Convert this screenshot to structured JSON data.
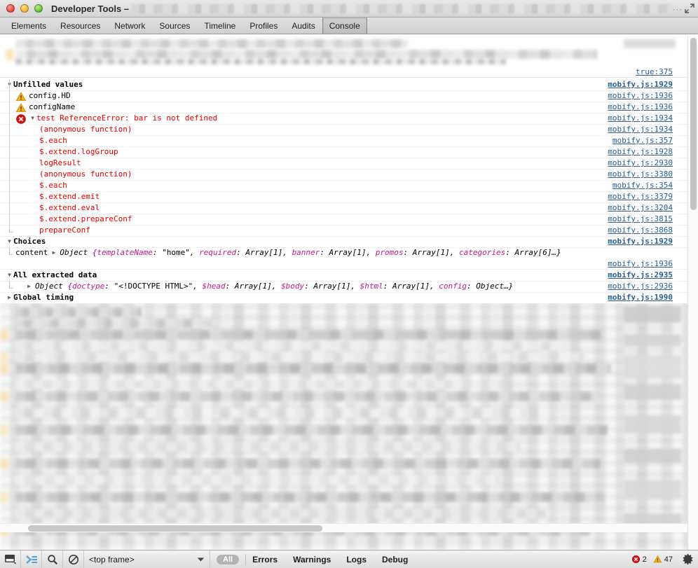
{
  "window": {
    "title": "Developer Tools –",
    "title_redacted": true,
    "ellipsis": "···",
    "controls": [
      "close",
      "minimize",
      "zoom"
    ],
    "resize_icon": "fullscreen-icon"
  },
  "tabs": [
    {
      "label": "Elements",
      "active": false
    },
    {
      "label": "Resources",
      "active": false
    },
    {
      "label": "Network",
      "active": false
    },
    {
      "label": "Sources",
      "active": false
    },
    {
      "label": "Timeline",
      "active": false
    },
    {
      "label": "Profiles",
      "active": false
    },
    {
      "label": "Audits",
      "active": false
    },
    {
      "label": "Console",
      "active": true
    }
  ],
  "console": {
    "top_source_link": "true:375",
    "groups": [
      {
        "name": "Unfilled values",
        "expanded": true,
        "source": "mobify.js:1929",
        "source_bold": true,
        "entries": [
          {
            "icon": "warning-icon",
            "text": "config.HD",
            "source": "mobify.js:1936",
            "level": "warning"
          },
          {
            "icon": "warning-icon",
            "text": "configName",
            "source": "mobify.js:1936",
            "level": "warning"
          }
        ]
      }
    ],
    "error_entry": {
      "icon": "error-icon",
      "expanded": true,
      "message": "test ReferenceError: bar is not defined",
      "source": "mobify.js:1934",
      "stack": [
        {
          "frame": "(anonymous function)",
          "source": "mobify.js:1934"
        },
        {
          "frame": "$.each",
          "source": "mobify.js:357"
        },
        {
          "frame": "$.extend.logGroup",
          "source": "mobify.js:1928"
        },
        {
          "frame": "logResult",
          "source": "mobify.js:2930"
        },
        {
          "frame": "(anonymous function)",
          "source": "mobify.js:3380"
        },
        {
          "frame": "$.each",
          "source": "mobify.js:354"
        },
        {
          "frame": "$.extend.emit",
          "source": "mobify.js:3379"
        },
        {
          "frame": "$.extend.eval",
          "source": "mobify.js:3204"
        },
        {
          "frame": "$.extend.prepareConf",
          "source": "mobify.js:3815"
        },
        {
          "frame": "prepareConf",
          "source": "mobify.js:3868"
        }
      ]
    },
    "choices_group": {
      "name": "Choices",
      "expanded": true,
      "source": "mobify.js:1929",
      "source_bold": true,
      "row": {
        "property": "content",
        "disclosure": "closed",
        "type": "Object",
        "preview": "{templateName: \"home\", required: Array[1], banner: Array[1], promos: Array[1], categories: Array[6]…}",
        "source": "mobify.js:1936",
        "parts": [
          {
            "k": "templateName",
            "v": "\"home\""
          },
          {
            "k": "required",
            "v": "Array[1]"
          },
          {
            "k": "banner",
            "v": "Array[1]"
          },
          {
            "k": "promos",
            "v": "Array[1]"
          },
          {
            "k": "categories",
            "v": "Array[6]…"
          }
        ]
      }
    },
    "extracted_group": {
      "name": "All extracted data",
      "expanded": true,
      "source": "mobify.js:2935",
      "source_bold": true,
      "row": {
        "disclosure": "closed",
        "type": "Object",
        "preview": "{doctype: \"<!DOCTYPE HTML>\", $head: Array[1], $body: Array[1], $html: Array[1], config: Object…}",
        "source": "mobify.js:2936",
        "parts": [
          {
            "k": "doctype",
            "v": "\"<!DOCTYPE HTML>\""
          },
          {
            "k": "$head",
            "v": "Array[1]"
          },
          {
            "k": "$body",
            "v": "Array[1]"
          },
          {
            "k": "$html",
            "v": "Array[1]"
          },
          {
            "k": "config",
            "v": "Object…"
          }
        ]
      }
    },
    "timing_group": {
      "name": "Global timing",
      "expanded": false,
      "source": "mobify.js:1990",
      "source_bold": true
    }
  },
  "toolbar": {
    "dock_icon": "dock-panel-icon",
    "prompt_icon": "console-prompt-icon",
    "search_icon": "search-icon",
    "clear_icon": "clear-console-icon",
    "frame_value": "<top frame>",
    "frame_caret": "chevron-down-icon",
    "all_label": "All",
    "filters": [
      "Errors",
      "Warnings",
      "Logs",
      "Debug"
    ],
    "error_count": "2",
    "warning_count": "47",
    "settings_icon": "gear-icon"
  },
  "colors": {
    "error_red": "#e70000",
    "warning_amber": "#f0a818",
    "link_blue": "#2a5d8f",
    "key_magenta": "#c41a8c",
    "brace_purple": "#8c00c8"
  }
}
